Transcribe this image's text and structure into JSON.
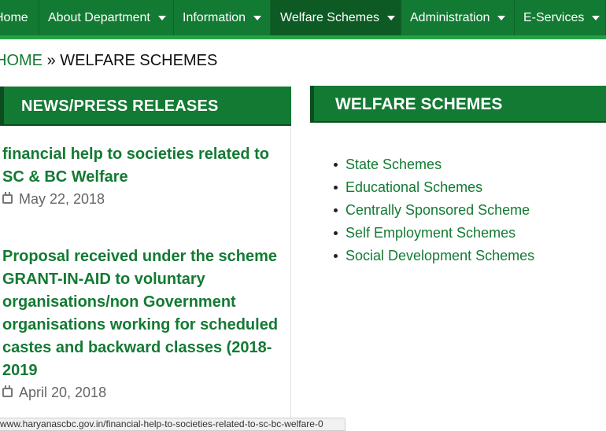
{
  "nav": {
    "items": [
      {
        "label": "Home",
        "caret": false
      },
      {
        "label": "About Department",
        "caret": true
      },
      {
        "label": "Information",
        "caret": true
      },
      {
        "label": "Welfare Schemes",
        "caret": true
      },
      {
        "label": "Administration",
        "caret": true
      },
      {
        "label": "E-Services",
        "caret": true
      }
    ],
    "active_item": "Welfare Schemes"
  },
  "breadcrumb": {
    "home": "HOME",
    "separator": "»",
    "current": "WELFARE SCHEMES"
  },
  "news": {
    "heading": "NEWS/PRESS RELEASES",
    "items": [
      {
        "title": "financial help to societies related to SC & BC Welfare",
        "date": "May 22, 2018",
        "icon": "calendar-icon"
      },
      {
        "title": "Proposal received under the scheme GRANT-IN-AID to voluntary organisations/non Government organisations working for scheduled castes and backward classes (2018-2019",
        "date": "April 20, 2018",
        "icon": "calendar-icon"
      }
    ]
  },
  "schemes": {
    "heading": "WELFARE SCHEMES",
    "items": [
      "State Schemes",
      "Educational Schemes",
      "Centrally Sponsored Scheme",
      "Self Employment Schemes",
      "Social Development Schemes"
    ]
  },
  "status_bar": {
    "url": "www.haryanascbc.gov.in/financial-help-to-societies-related-to-sc-bc-welfare-0"
  },
  "colors": {
    "primary_green": "#137a33",
    "dark_green": "#0b4d1f",
    "active_nav": "#0d5a25",
    "nav_underline": "#25a146"
  }
}
